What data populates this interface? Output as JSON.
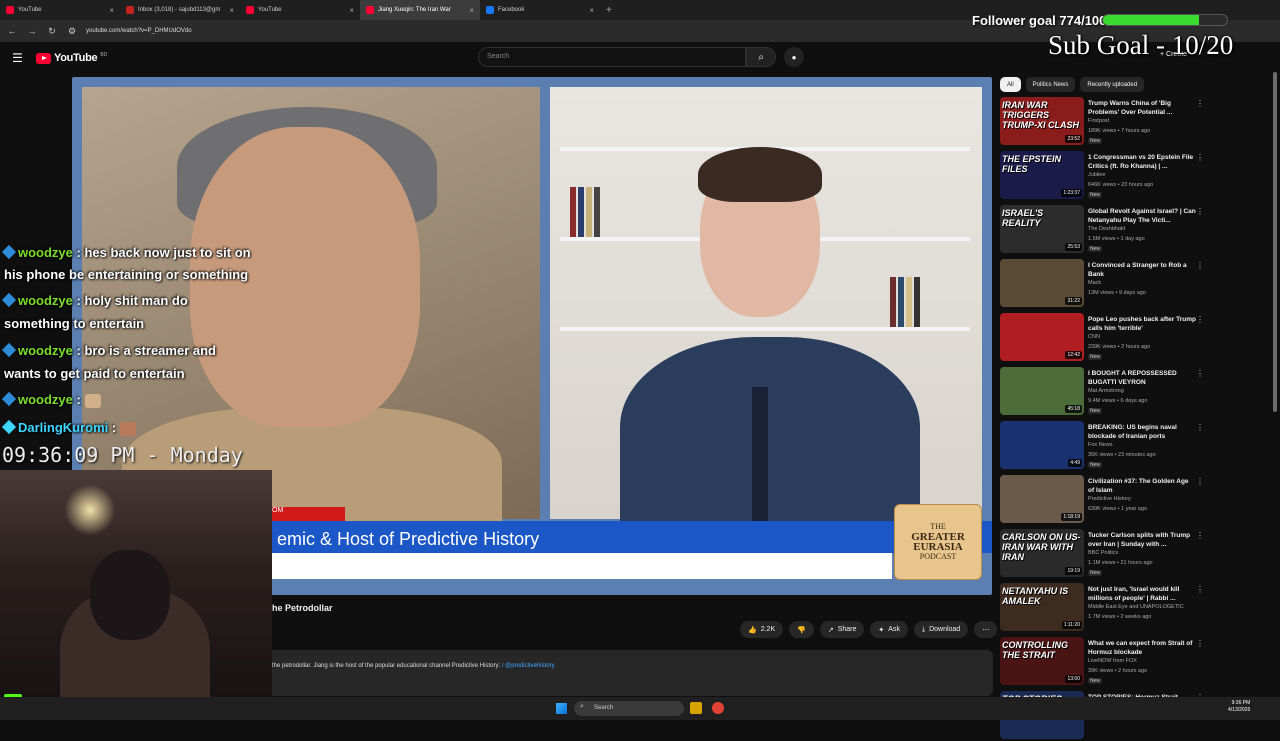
{
  "browser": {
    "tabs": [
      {
        "label": "YouTube",
        "fav": "#ff0033"
      },
      {
        "label": "Inbox (3,018) - sajubd113@gm",
        "fav": "#c5221f"
      },
      {
        "label": "YouTube",
        "fav": "#ff0033"
      },
      {
        "label": "Jiang Xueqin: The Iran War",
        "fav": "#ff0033"
      },
      {
        "label": "Facebook",
        "fav": "#1877f2"
      }
    ],
    "url": "youtube.com/watch?v=P_DHMUdOVdo"
  },
  "youtube": {
    "logo_text": "YouTube",
    "country": "BD",
    "search_placeholder": "Search",
    "create_label": "Create"
  },
  "video": {
    "lower_third_text": "emic & Host of Predictive History",
    "lower_third_tag": "OM",
    "badge_lines": [
      "THE",
      "GREATER",
      "EURASIA",
      "PODCAST"
    ],
    "title_partial": "he Petrodollar",
    "description_partial": "the petrodollar. Jiang is the host of the popular educational channel Predictive History:",
    "description_link": "/ @predictivehistory"
  },
  "actions": {
    "likes": "2.2K",
    "share": "Share",
    "ask": "Ask",
    "download": "Download"
  },
  "chips": [
    "All",
    "Politics News",
    "Recently uploaded"
  ],
  "recommendations": [
    {
      "thumb_text": "IRAN WAR TRIGGERS TRUMP-XI CLASH",
      "title": "Trump Warns China of 'Big Problems' Over Potential ...",
      "channel": "Firstpost",
      "meta": "189K views • 7 hours ago",
      "new": "New",
      "duration": "23:52",
      "color": "#8a1c1c"
    },
    {
      "thumb_text": "THE EPSTEIN FILES",
      "title": "1 Congressman vs 20 Epstein File Critics (ft. Ro Khanna) | ...",
      "channel": "Jubilee",
      "meta": "646K views • 23 hours ago",
      "new": "New",
      "duration": "1:23:37",
      "color": "#1b1b4a"
    },
    {
      "thumb_text": "ISRAEL'S REALITY",
      "title": "Global Revolt Against Israel? | Can Netanyahu Play The Victi...",
      "channel": "The Deshbhakt",
      "meta": "1.5M views • 1 day ago",
      "new": "New",
      "duration": "25:53",
      "color": "#2c2c2c"
    },
    {
      "thumb_text": "",
      "title": "I Convinced a Stranger to Rob a Bank",
      "channel": "Mack",
      "meta": "13M views • 9 days ago",
      "new": "",
      "duration": "31:22",
      "color": "#5b4a36"
    },
    {
      "thumb_text": "",
      "title": "Pope Leo pushes back after Trump calls him 'terrible'",
      "channel": "CNN",
      "meta": "239K views • 2 hours ago",
      "new": "New",
      "duration": "12:42",
      "color": "#b01e22"
    },
    {
      "thumb_text": "",
      "title": "I BOUGHT A REPOSSESSED BUGATTI VEYRON",
      "channel": "Mat Armstrong",
      "meta": "9.4M views • 6 days ago",
      "new": "New",
      "duration": "45:18",
      "color": "#4c6d3a"
    },
    {
      "thumb_text": "",
      "title": "BREAKING: US begins naval blockade of Iranian ports",
      "channel": "Fox News",
      "meta": "35K views • 23 minutes ago",
      "new": "New",
      "duration": "4:49",
      "color": "#1a3370"
    },
    {
      "thumb_text": "",
      "title": "Civilization #37: The Golden Age of Islam",
      "channel": "Predictive History",
      "meta": "639K views • 1 year ago",
      "new": "",
      "duration": "1:18:19",
      "color": "#6b5a4a"
    },
    {
      "thumb_text": "CARLSON ON US-IRAN WAR WITH IRAN",
      "title": "Tucker Carlson splits with Trump over Iran | Sunday with ...",
      "channel": "BBC Politics",
      "meta": "1.1M views • 21 hours ago",
      "new": "New",
      "duration": "19:19",
      "color": "#2a2a2a"
    },
    {
      "thumb_text": "NETANYAHU IS AMALEK",
      "title": "Not just Iran, 'Israel would kill millions of people' | Rabbi ...",
      "channel": "Middle East Eye and UNAPOLOGETIC",
      "meta": "1.7M views • 2 weeks ago",
      "new": "",
      "duration": "1:11:20",
      "color": "#3d2b20"
    },
    {
      "thumb_text": "CONTROLLING THE STRAIT",
      "title": "What we can expect from Strait of Hormuz blockade",
      "channel": "LiveNOW from FOX",
      "meta": "39K views • 2 hours ago",
      "new": "New",
      "duration": "13:00",
      "color": "#4a1414"
    },
    {
      "thumb_text": "TOP STORIES",
      "title": "TOP STORIES: Hormuz Strait",
      "channel": "",
      "meta": "",
      "new": "",
      "duration": "",
      "color": "#1a2a55"
    }
  ],
  "overlay": {
    "follower_goal": "Follower goal 774/1000",
    "follower_fraction": 0.774,
    "sub_goal": "Sub Goal - 10/20",
    "clock": "09:36:09 PM - Monday",
    "viewers": "3",
    "kick_letter": "K",
    "chat": [
      {
        "user": "",
        "text": "hes back now just to sit on"
      },
      {
        "user": "",
        "text": "his phone be entertaining or something"
      },
      {
        "user": "woodzye",
        "text": ": holy shit man do"
      },
      {
        "user": "",
        "text": "something to entertain"
      },
      {
        "user": "woodzye",
        "text": ": bro is a streamer and"
      },
      {
        "user": "",
        "text": "wants to get paid to entertain"
      },
      {
        "user": "woodzye",
        "text": ":"
      },
      {
        "user": "DarlingKuromi",
        "text": ":"
      }
    ],
    "chat_first_user": "woodzye"
  },
  "taskbar": {
    "search": "Search",
    "time": "9:36 PM",
    "date": "4/13/2026"
  }
}
